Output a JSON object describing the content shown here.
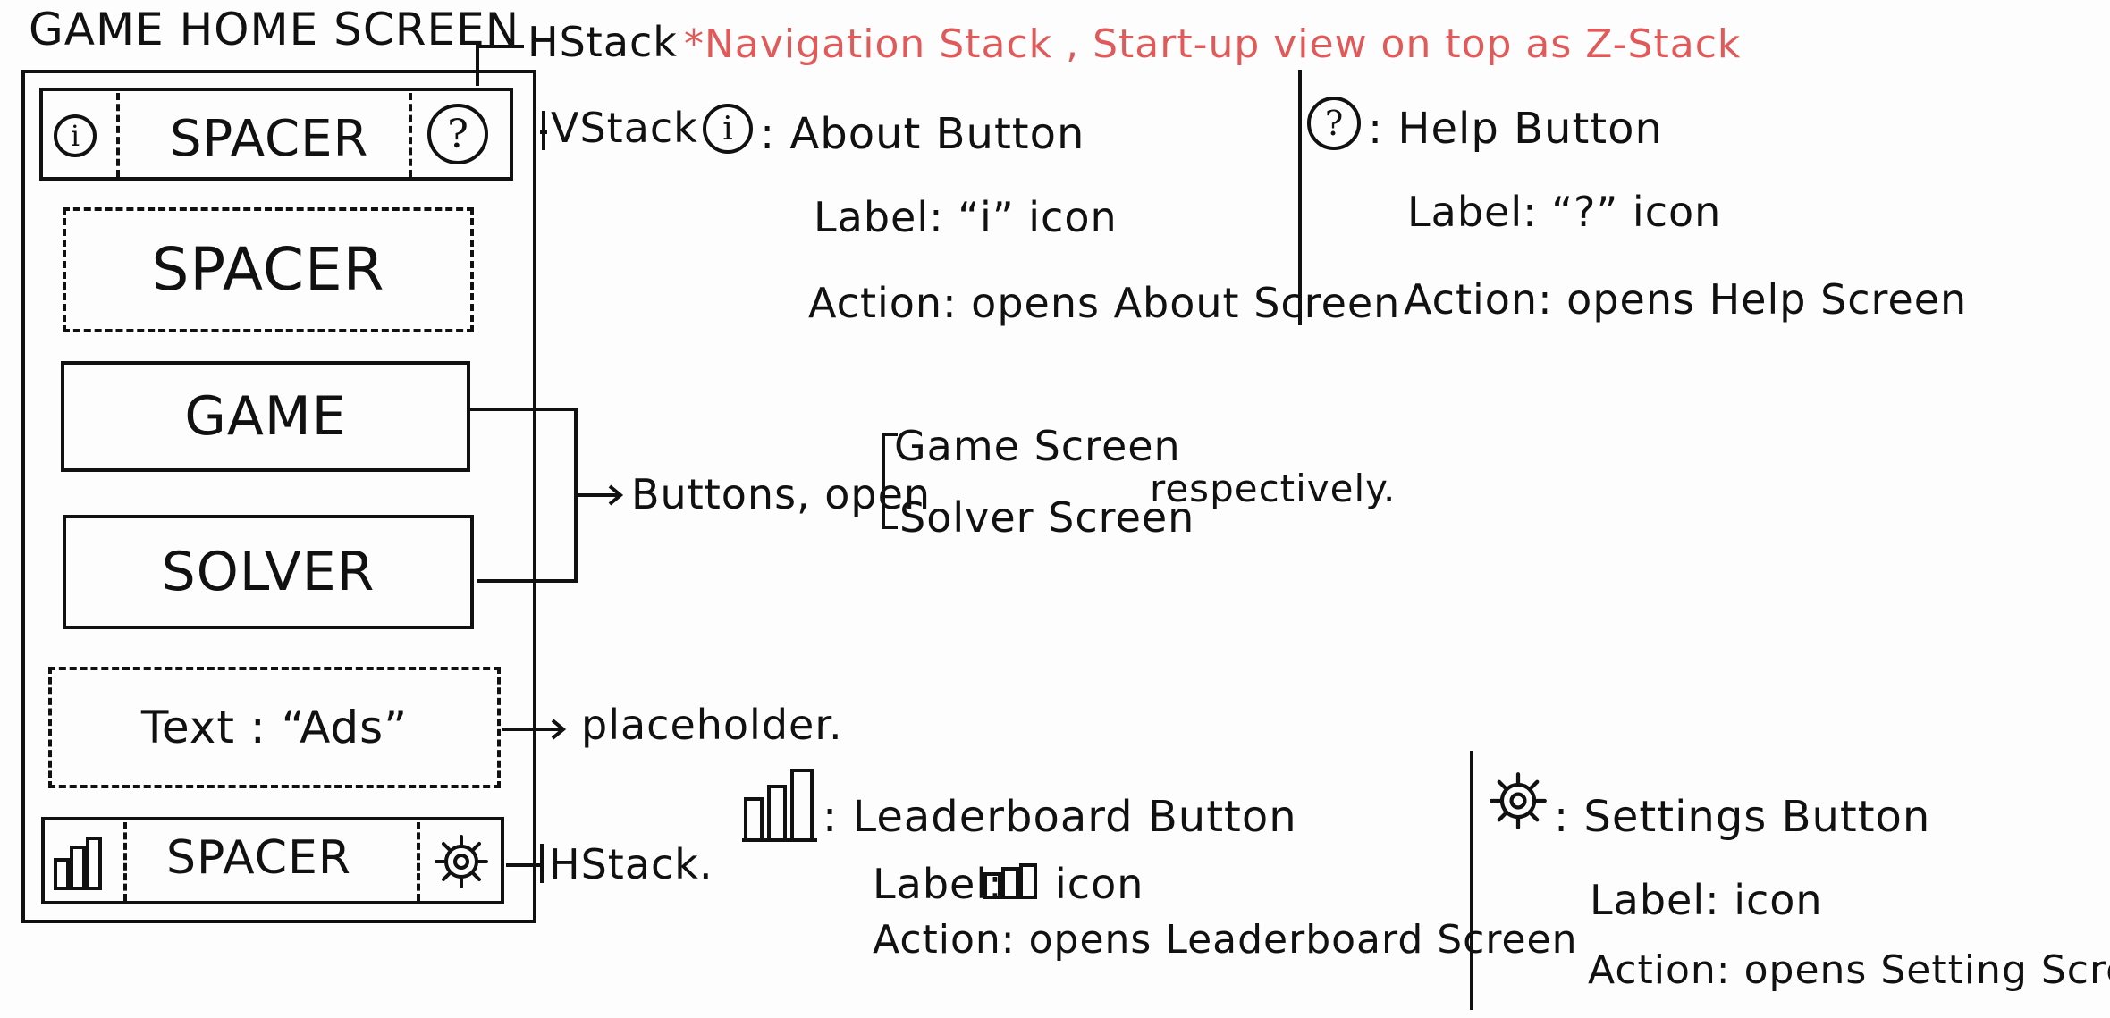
{
  "title": "GAME HOME SCREEN",
  "nav_note": "*Navigation Stack , Start-up view on top as Z-Stack",
  "phone": {
    "top_bar": {
      "info_glyph": "i",
      "spacer_label": "SPACER",
      "help_glyph": "?"
    },
    "spacer_label": "SPACER",
    "game_button_label": "GAME",
    "solver_button_label": "SOLVER",
    "ads_text": "Text : “Ads”",
    "bottom_bar": {
      "spacer_label": "SPACER"
    }
  },
  "annotations": {
    "hstack_top": "HStack",
    "vstack": "VStack",
    "hstack_bottom": "HStack.",
    "buttons_open": "Buttons, open",
    "game_screen": "Game Screen",
    "solver_screen": "Solver Screen",
    "respectively": "respectively.",
    "placeholder": "placeholder."
  },
  "about": {
    "glyph": "i",
    "title": ": About Button",
    "label": "Label: “i” icon",
    "action": "Action: opens About Screen"
  },
  "help": {
    "glyph": "?",
    "title": ": Help Button",
    "label": "Label: “?” icon",
    "action": "Action: opens Help Screen"
  },
  "leaderboard": {
    "title": ": Leaderboard Button",
    "label_prefix": "Label:",
    "label_suffix": "icon",
    "action": "Action: opens Leaderboard Screen"
  },
  "settings": {
    "title": ": Settings Button",
    "label": "Label: icon",
    "action": "Action: opens Setting Screen."
  },
  "icons": {
    "info": "info-icon",
    "help": "help-icon",
    "leaderboard": "bar-chart-icon",
    "settings": "gear-icon"
  },
  "colors": {
    "ink": "#111111",
    "accent_note": "#e05a5a"
  }
}
